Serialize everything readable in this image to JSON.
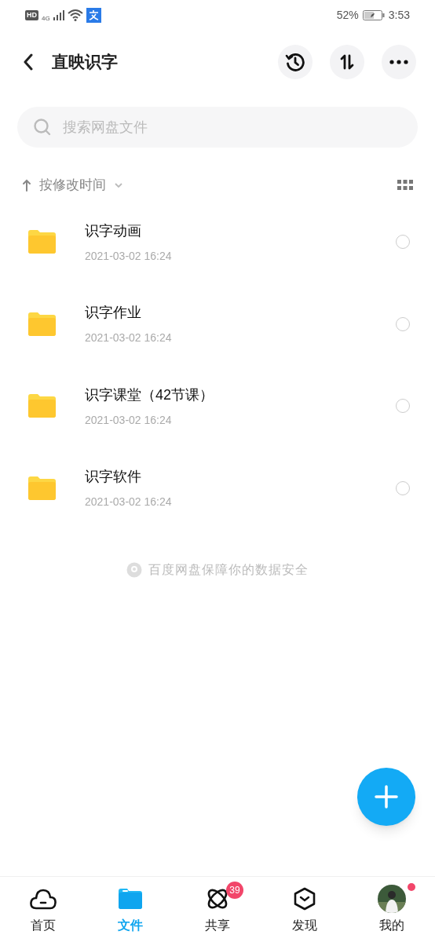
{
  "status_bar": {
    "hd": "HD",
    "network": "4G",
    "battery": "52%",
    "time": "3:53"
  },
  "header": {
    "title": "直映识字"
  },
  "search": {
    "placeholder": "搜索网盘文件"
  },
  "sort": {
    "label": "按修改时间"
  },
  "files": [
    {
      "name": "识字动画",
      "date": "2021-03-02 16:24",
      "selected": false
    },
    {
      "name": "识字作业",
      "date": "2021-03-02 16:24",
      "selected": false
    },
    {
      "name": "识字课堂（42节课）",
      "date": "2021-03-02 16:24",
      "selected": false
    },
    {
      "name": "识字软件",
      "date": "2021-03-02 16:24",
      "selected": false
    }
  ],
  "footer_note": "百度网盘保障你的数据安全",
  "bottom_nav": [
    {
      "kind": "home",
      "label": "首页",
      "selected": false
    },
    {
      "kind": "files",
      "label": "文件",
      "selected": true
    },
    {
      "kind": "share",
      "label": "共享",
      "selected": false,
      "badge": "39"
    },
    {
      "kind": "discover",
      "label": "发现",
      "selected": false
    },
    {
      "kind": "me",
      "label": "我的",
      "selected": false,
      "dot": true
    }
  ]
}
